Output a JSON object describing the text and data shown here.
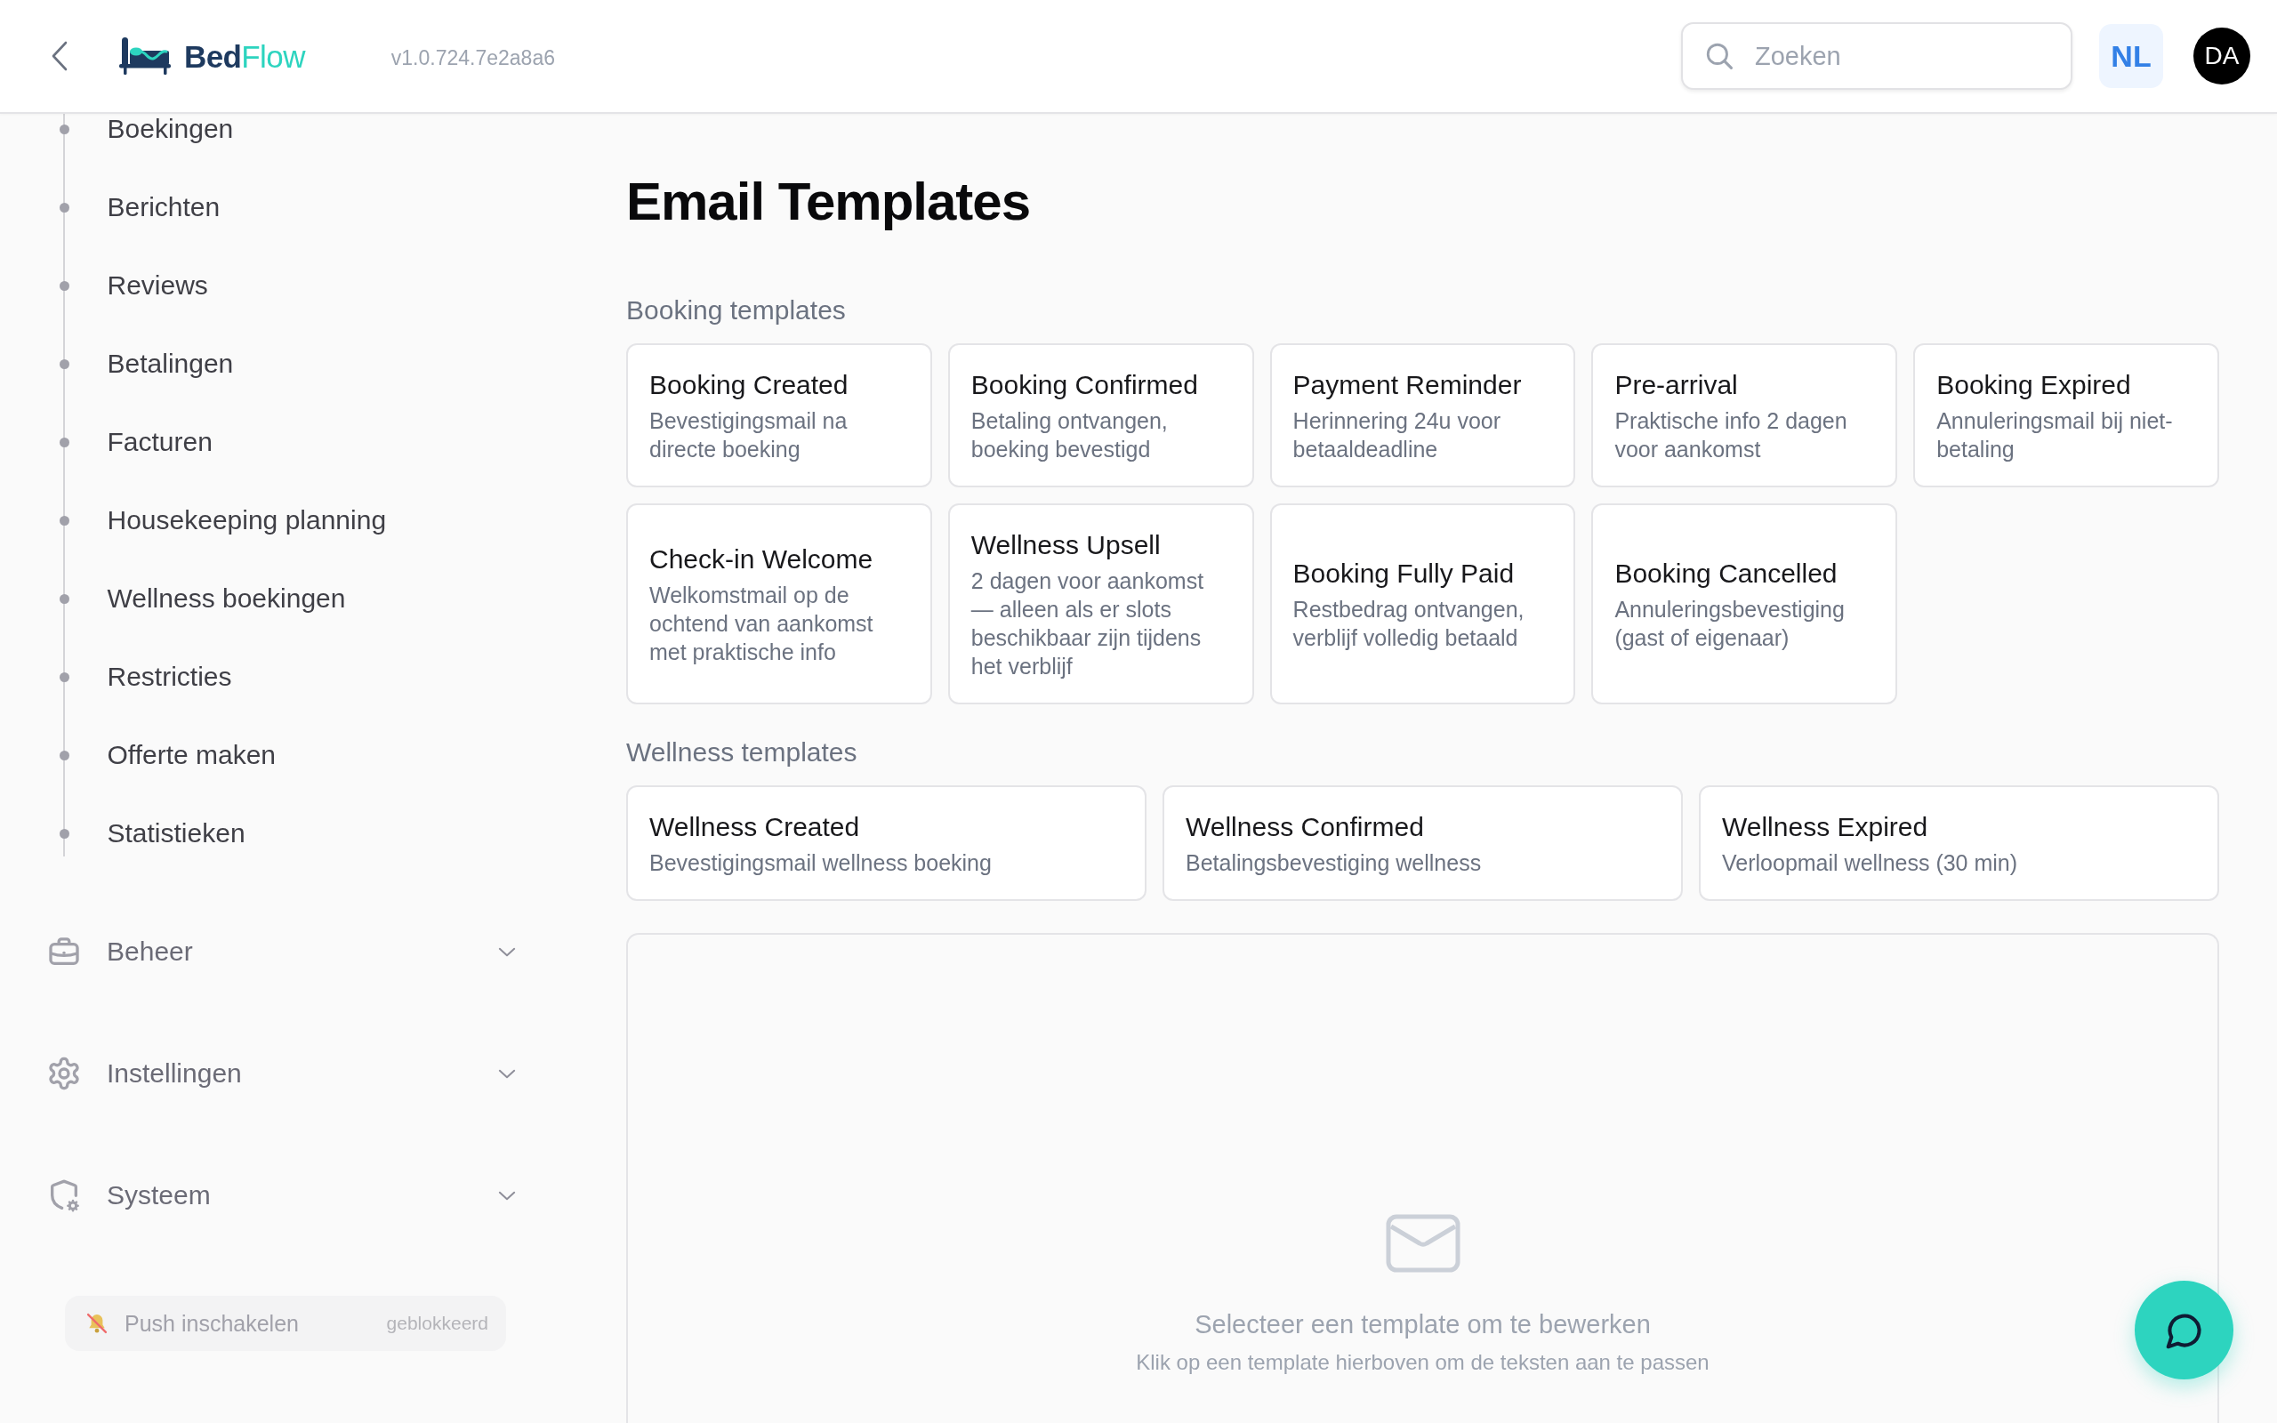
{
  "header": {
    "logo": "**Bed**Flow",
    "version": "v1.0.724.7e2a8a6",
    "search": {
      "placeholder": "Zoeken"
    },
    "language": "NL",
    "avatar": "DA"
  },
  "sidebar": {
    "items": [
      {
        "label": "Boekingen",
        "selected": false
      },
      {
        "label": "Berichten",
        "selected": false
      },
      {
        "label": "Reviews",
        "selected": false
      },
      {
        "label": "Betalingen",
        "selected": false
      },
      {
        "label": "Facturen",
        "selected": false
      },
      {
        "label": "Housekeeping planning",
        "selected": false
      },
      {
        "label": "Wellness boekingen",
        "selected": false
      },
      {
        "label": "Restricties",
        "selected": false
      },
      {
        "label": "Offerte maken",
        "selected": false
      },
      {
        "label": "Statistieken",
        "selected": false
      }
    ],
    "groups": [
      {
        "label": "Beheer",
        "expanded": false
      },
      {
        "label": "Instellingen",
        "expanded": false
      },
      {
        "label": "Systeem",
        "expanded": false
      }
    ],
    "push": {
      "label": "Push inschakelen",
      "status": "geblokkeerd",
      "disabled": true
    }
  },
  "main": {
    "title": "Email Templates",
    "sections": [
      {
        "label": "Booking templates",
        "templates": [
          {
            "title": "Booking Created",
            "description": "Bevestigingsmail na directe boeking",
            "selected": false
          },
          {
            "title": "Booking Confirmed",
            "description": "Betaling ontvangen, boeking bevestigd",
            "selected": false
          },
          {
            "title": "Payment Reminder",
            "description": "Herinnering 24u voor betaaldeadline",
            "selected": false
          },
          {
            "title": "Pre-arrival",
            "description": "Praktische info 2 dagen voor aankomst",
            "selected": false
          },
          {
            "title": "Booking Expired",
            "description": "Annuleringsmail bij niet-betaling",
            "selected": false
          },
          {
            "title": "Check-in Welcome",
            "description": "Welkomstmail op de ochtend van aankomst met praktische info",
            "selected": false
          },
          {
            "title": "Wellness Upsell",
            "description": "2 dagen voor aankomst — alleen als er slots beschikbaar zijn tijdens het verblijf",
            "selected": false
          },
          {
            "title": "Booking Fully Paid",
            "description": "Restbedrag ontvangen, verblijf volledig betaald",
            "selected": false
          },
          {
            "title": "Booking Cancelled",
            "description": "Annuleringsbevestiging (gast of eigenaar)",
            "selected": false
          }
        ]
      },
      {
        "label": "Wellness templates",
        "templates": [
          {
            "title": "Wellness Created",
            "description": "Bevestigingsmail wellness boeking",
            "selected": false
          },
          {
            "title": "Wellness Confirmed",
            "description": "Betalingsbevestiging wellness",
            "selected": false
          },
          {
            "title": "Wellness Expired",
            "description": "Verloopmail wellness (30 min)",
            "selected": false
          }
        ]
      }
    ],
    "editor": {
      "empty_title": "Selecteer een template om te bewerken",
      "empty_hint": "Klik op een template hierboven om de teksten aan te passen"
    }
  }
}
